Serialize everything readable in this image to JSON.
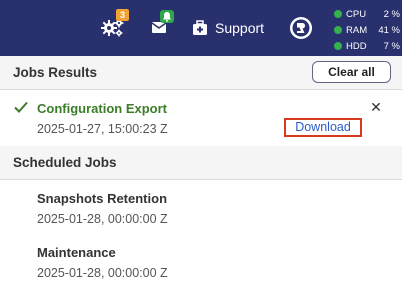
{
  "header": {
    "jobs_badge": "3",
    "support_label": "Support",
    "stats": [
      {
        "name": "CPU",
        "value": "2 %"
      },
      {
        "name": "RAM",
        "value": "41 %"
      },
      {
        "name": "HDD",
        "value": "7 %"
      }
    ],
    "colors": {
      "bar": "#28306e",
      "jobs_badge": "#f0a232",
      "notif_badge": "#2fa64a",
      "stat_ok": "#37b04f"
    }
  },
  "jobs_results": {
    "title": "Jobs Results",
    "clear_all_label": "Clear all",
    "items": [
      {
        "name": "Configuration Export",
        "date": "2025-01-27, 15:00:23 Z",
        "action": "Download",
        "status": "success"
      }
    ]
  },
  "scheduled_jobs": {
    "title": "Scheduled Jobs",
    "items": [
      {
        "name": "Snapshots Retention",
        "date": "2025-01-28, 00:00:00 Z"
      },
      {
        "name": "Maintenance",
        "date": "2025-01-28, 00:00:00 Z"
      }
    ]
  }
}
